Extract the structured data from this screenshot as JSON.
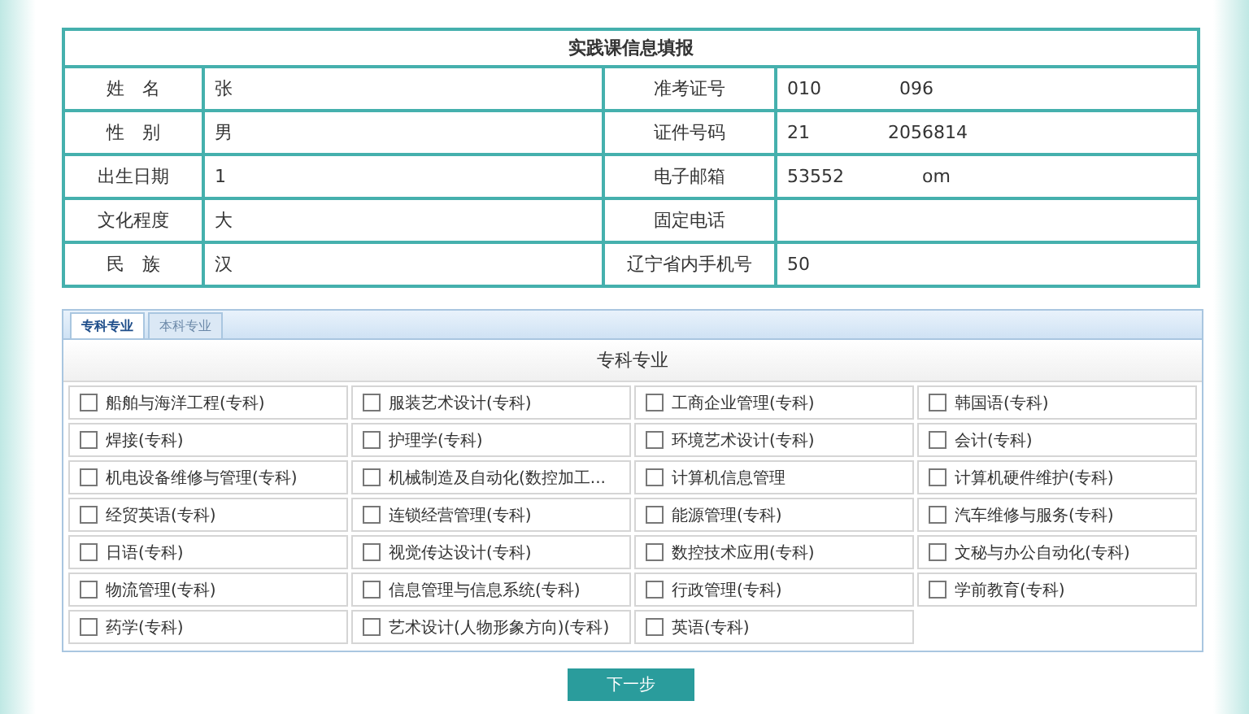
{
  "info_table": {
    "title": "实践课信息填报",
    "rows": [
      {
        "label": "姓　名",
        "value": [
          "张"
        ],
        "label2": "准考证号",
        "value2": [
          "010",
          "096"
        ]
      },
      {
        "label": "性　别",
        "value": [
          "男"
        ],
        "label2": "证件号码",
        "value2": [
          "21",
          "2056814"
        ]
      },
      {
        "label": "出生日期",
        "value": [
          "1"
        ],
        "label2": "电子邮箱",
        "value2": [
          "53552",
          "om"
        ]
      },
      {
        "label": "文化程度",
        "value": [
          "大"
        ],
        "label2": "固定电话",
        "value2": []
      },
      {
        "label": "民　族",
        "value": [
          "汉"
        ],
        "label2": "辽宁省内手机号",
        "value2": [
          "50"
        ]
      }
    ]
  },
  "tabs": [
    {
      "label": "专科专业",
      "selected": true
    },
    {
      "label": "本科专业",
      "selected": false
    }
  ],
  "majors": {
    "heading": "专科专业",
    "items": [
      {
        "label": "船舶与海洋工程(专科)",
        "checked": false
      },
      {
        "label": "服装艺术设计(专科)",
        "checked": false
      },
      {
        "label": "工商企业管理(专科)",
        "checked": false
      },
      {
        "label": "韩国语(专科)",
        "checked": false
      },
      {
        "label": "焊接(专科)",
        "checked": false
      },
      {
        "label": "护理学(专科)",
        "checked": false
      },
      {
        "label": "环境艺术设计(专科)",
        "checked": false
      },
      {
        "label": "会计(专科)",
        "checked": false
      },
      {
        "label": "机电设备维修与管理(专科)",
        "checked": false
      },
      {
        "label": "机械制造及自动化(数控加工...",
        "checked": false
      },
      {
        "label": "计算机信息管理",
        "checked": false
      },
      {
        "label": "计算机硬件维护(专科)",
        "checked": false
      },
      {
        "label": "经贸英语(专科)",
        "checked": false
      },
      {
        "label": "连锁经营管理(专科)",
        "checked": false
      },
      {
        "label": "能源管理(专科)",
        "checked": false
      },
      {
        "label": "汽车维修与服务(专科)",
        "checked": false
      },
      {
        "label": "日语(专科)",
        "checked": false
      },
      {
        "label": "视觉传达设计(专科)",
        "checked": false
      },
      {
        "label": "数控技术应用(专科)",
        "checked": false
      },
      {
        "label": "文秘与办公自动化(专科)",
        "checked": false
      },
      {
        "label": "物流管理(专科)",
        "checked": false
      },
      {
        "label": "信息管理与信息系统(专科)",
        "checked": false
      },
      {
        "label": "行政管理(专科)",
        "checked": false
      },
      {
        "label": "学前教育(专科)",
        "checked": false
      },
      {
        "label": "药学(专科)",
        "checked": false
      },
      {
        "label": "艺术设计(人物形象方向)(专科)",
        "checked": false
      },
      {
        "label": "英语(专科)",
        "checked": false
      }
    ]
  },
  "next_button": "下一步"
}
